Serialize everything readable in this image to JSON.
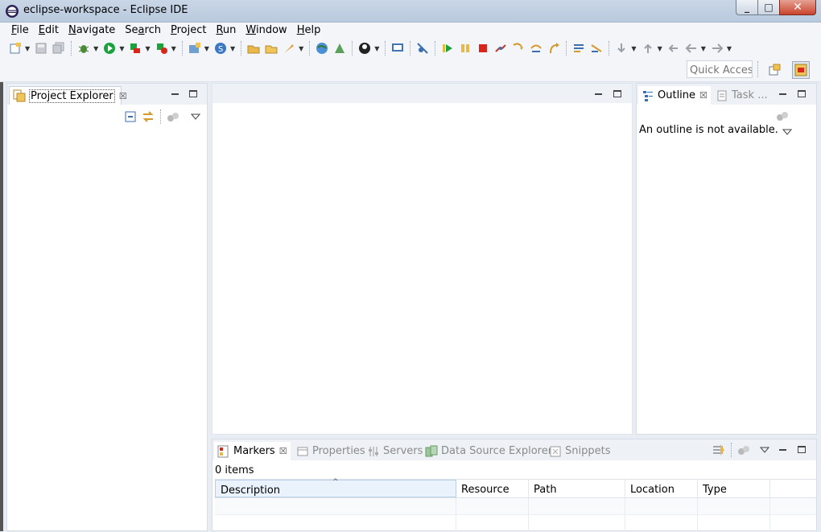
{
  "window": {
    "title": "eclipse-workspace - Eclipse IDE",
    "controls": {
      "minimize": "_",
      "maximize": "□",
      "close": "✕"
    }
  },
  "menu": [
    {
      "label": "File",
      "mnemonic": "F",
      "rest": "ile"
    },
    {
      "label": "Edit",
      "mnemonic": "E",
      "rest": "dit"
    },
    {
      "label": "Navigate",
      "mnemonic": "N",
      "rest": "avigate"
    },
    {
      "label": "Search",
      "mnemonic": "a",
      "pre": "Se",
      "rest": "rch"
    },
    {
      "label": "Project",
      "mnemonic": "P",
      "rest": "roject"
    },
    {
      "label": "Run",
      "mnemonic": "R",
      "rest": "un"
    },
    {
      "label": "Window",
      "mnemonic": "W",
      "rest": "indow"
    },
    {
      "label": "Help",
      "mnemonic": "H",
      "rest": "elp"
    }
  ],
  "toolbar": {
    "quick_access_placeholder": "Quick Access"
  },
  "project_explorer": {
    "tab_label": "Project Explorer",
    "close_glyph": "☒"
  },
  "outline": {
    "tab_label": "Outline",
    "second_tab_label": "Task ...",
    "message": "An outline is not available.",
    "close_glyph": "☒"
  },
  "bottom_panel": {
    "tabs": [
      {
        "label": "Markers",
        "active": true
      },
      {
        "label": "Properties",
        "active": false
      },
      {
        "label": "Servers",
        "active": false
      },
      {
        "label": "Data Source Explorer",
        "active": false
      },
      {
        "label": "Snippets",
        "active": false
      }
    ],
    "close_glyph": "☒",
    "items_count": "0 items",
    "columns": [
      "Description",
      "Resource",
      "Path",
      "Location",
      "Type"
    ],
    "sort_glyph": "^"
  },
  "colors": {
    "accent": "#3c7fb1",
    "run_green": "#1aa33c",
    "stop_red": "#d9261c",
    "folder_yellow": "#e8b84a"
  }
}
